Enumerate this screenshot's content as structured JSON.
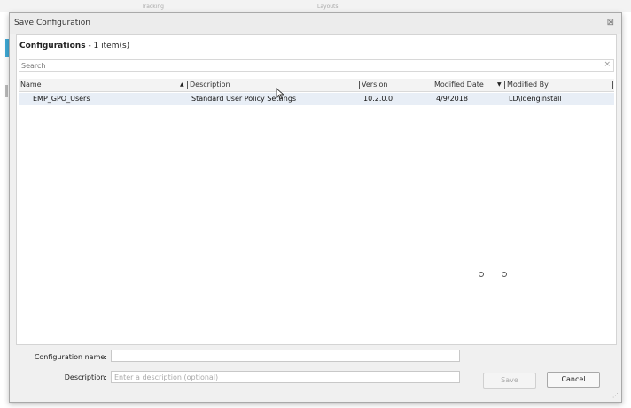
{
  "window": {
    "title": "Save Configuration",
    "close_glyph": "⊠"
  },
  "configurations": {
    "heading": "Configurations",
    "count_text": "- 1 item(s)"
  },
  "search": {
    "placeholder": "Search",
    "clear_glyph": "×"
  },
  "grid": {
    "columns": [
      {
        "label": "Name",
        "sort": "ascending"
      },
      {
        "label": "Description"
      },
      {
        "label": "Version"
      },
      {
        "label": "Modified Date",
        "sort": "descending"
      },
      {
        "label": "Modified By"
      }
    ],
    "rows": [
      {
        "name": "EMP_GPO_Users",
        "description": "Standard User Policy Settings",
        "version": "10.2.0.0",
        "modified_date": "4/9/2018",
        "modified_by": "LD\\ldenginstall"
      }
    ]
  },
  "form": {
    "config_name_label": "Configuration name:",
    "config_name_value": "",
    "description_label": "Description:",
    "description_placeholder": "Enter a description (optional)"
  },
  "buttons": {
    "save": "Save",
    "cancel": "Cancel"
  },
  "background": {
    "tab1": "Tracking",
    "tab2": "Layouts"
  },
  "colors": {
    "selected_row": "#e8eef6",
    "accent": "#3fa9d6"
  },
  "icons": {
    "sort_asc": "▲",
    "sort_desc": "▼",
    "resize": "⋰"
  }
}
